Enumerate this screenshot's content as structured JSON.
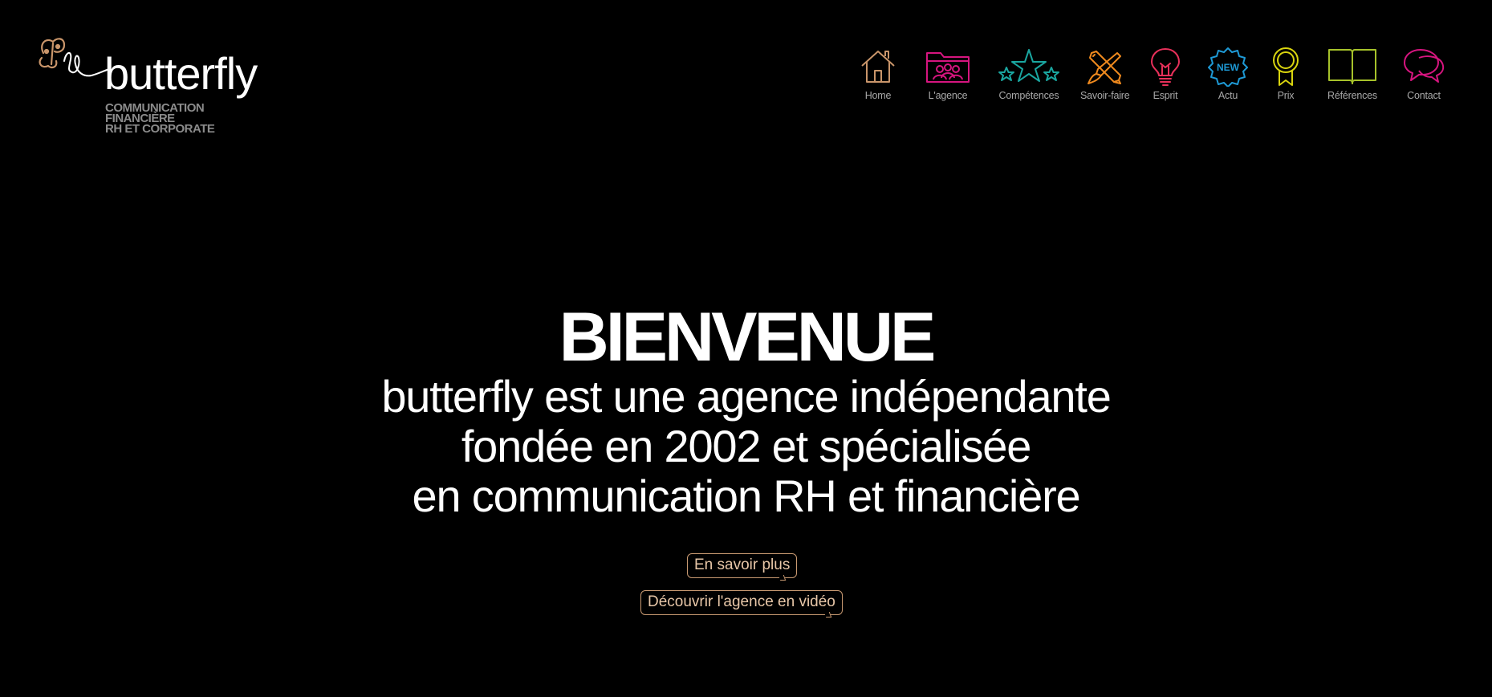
{
  "brand": {
    "name": "butterfly",
    "tagline": [
      "COMMUNICATION",
      "FINANCIÈRE",
      "RH ET CORPORATE"
    ],
    "mark_color": "#c9956a"
  },
  "nav": {
    "items": [
      {
        "label": "Home",
        "icon": "house-icon",
        "color": "#c9956a"
      },
      {
        "label": "L'agence",
        "icon": "team-folder-icon",
        "color": "#d6157f"
      },
      {
        "label": "Compétences",
        "icon": "stars-icon",
        "color": "#1aa6a0"
      },
      {
        "label": "Savoir-faire",
        "icon": "pencil-brush-icon",
        "color": "#f08a1e"
      },
      {
        "label": "Esprit",
        "icon": "lightbulb-icon",
        "color": "#e8305a"
      },
      {
        "label": "Actu",
        "icon": "new-badge-icon",
        "color": "#1e9ad6",
        "badge_text": "NEW"
      },
      {
        "label": "Prix",
        "icon": "award-ribbon-icon",
        "color": "#d9d40e"
      },
      {
        "label": "Références",
        "icon": "open-book-icon",
        "color": "#a6c22a"
      },
      {
        "label": "Contact",
        "icon": "speech-bubbles-icon",
        "color": "#d6157f"
      }
    ]
  },
  "hero": {
    "title": "BIENVENUE",
    "lines": [
      "butterfly est une agence indépendante",
      "fondée en 2002 et spécialisée",
      "en communication RH et financière"
    ],
    "cta_primary": "En savoir plus",
    "cta_secondary": "Découvrir l'agence en vidéo",
    "cta_color": "#c99a72"
  }
}
